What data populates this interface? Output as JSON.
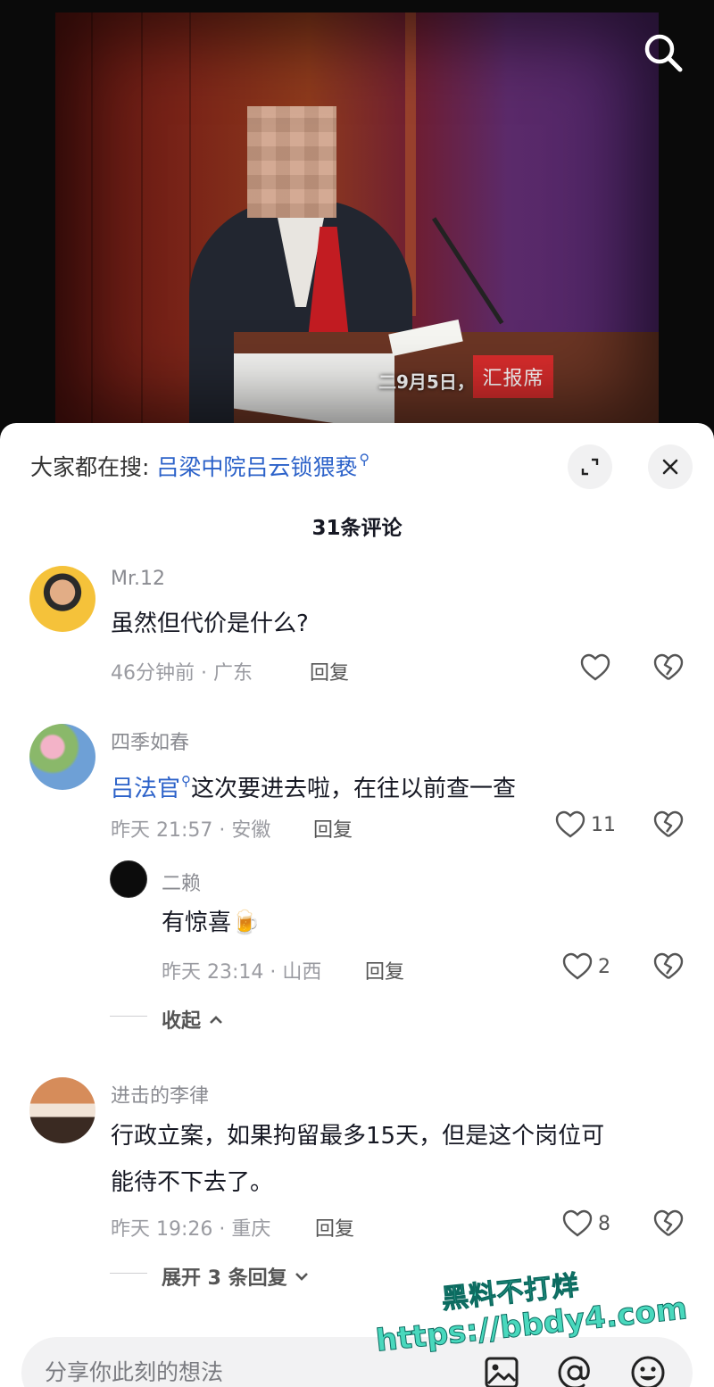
{
  "video": {
    "caption": "二9月5日，",
    "sign_text": "汇报席"
  },
  "header": {
    "hot_search_prefix": "大家都在搜:",
    "hot_search_keyword": "吕梁中院吕云锁猥亵",
    "search_glyph": "⚲",
    "comment_count": "31条评论"
  },
  "comments": [
    {
      "username": "Mr.12",
      "text": "虽然但代价是什么?",
      "meta": "46分钟前 · 广东",
      "reply_label": "回复",
      "likes": ""
    },
    {
      "username": "四季如春",
      "link_text": "吕法官",
      "text": "这次要进去啦，在往以前查一查",
      "meta": "昨天 21:57 · 安徽",
      "reply_label": "回复",
      "likes": "11",
      "replies": [
        {
          "username": "二赖",
          "text": "有惊喜",
          "emoji": "🍺",
          "meta": "昨天 23:14 · 山西",
          "reply_label": "回复",
          "likes": "2"
        }
      ],
      "collapse_label": "收起"
    },
    {
      "username": "进击的李律",
      "text_line1": "行政立案，如果拘留最多15天，但是这个岗位可",
      "text_line2": "能待不下去了。",
      "meta": "昨天 19:26 · 重庆",
      "reply_label": "回复",
      "likes": "8",
      "expand_label": "展开 3 条回复"
    }
  ],
  "input": {
    "placeholder": "分享你此刻的想法"
  },
  "watermark": {
    "line1": "黑料不打烊",
    "line2": "https://bbdy4.com"
  },
  "colors": {
    "link": "#2c62c9",
    "watermark": "#49d8bd"
  }
}
